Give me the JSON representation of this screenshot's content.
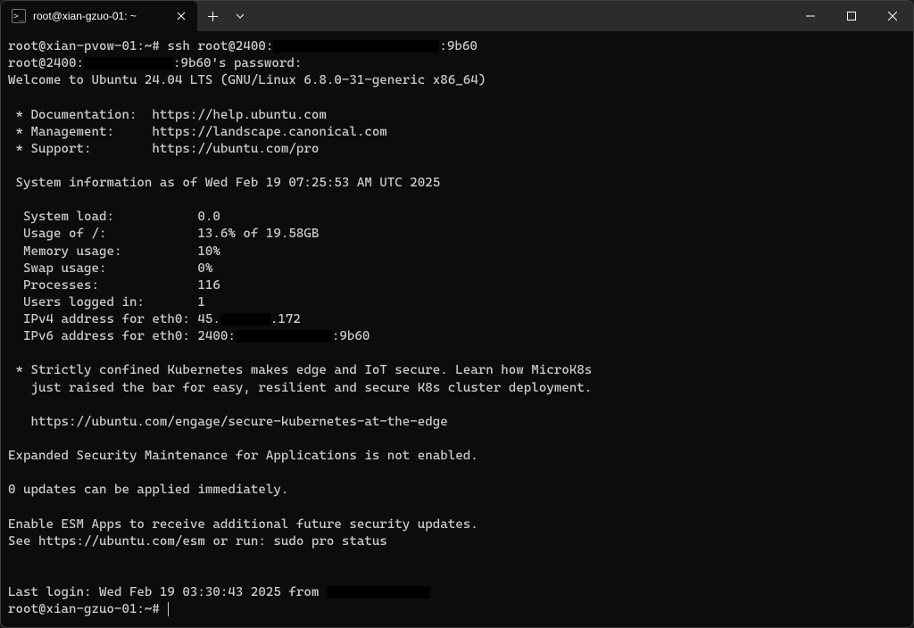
{
  "window": {
    "tab_title": "root@xian-gzuo-01: ~",
    "tab_icon_glyph": ">_"
  },
  "terminal": {
    "prompt1_user_host": "root@xian-pvow-01:~# ",
    "prompt1_cmd": "ssh root@2400:",
    "prompt1_suffix": ":9b60",
    "line2_a": "root@2400:",
    "line2_b": ":9b60's password:",
    "welcome": "Welcome to Ubuntu 24.04 LTS (GNU/Linux 6.8.0-31-generic x86_64)",
    "doc_line": " * Documentation:  https://help.ubuntu.com",
    "mgmt_line": " * Management:     https://landscape.canonical.com",
    "support_line": " * Support:        https://ubuntu.com/pro",
    "sysinfo_header": " System information as of Wed Feb 19 07:25:53 AM UTC 2025",
    "stats": {
      "load": "  System load:           0.0",
      "usage": "  Usage of /:            13.6% of 19.58GB",
      "mem": "  Memory usage:          10%",
      "swap": "  Swap usage:            0%",
      "procs": "  Processes:             116",
      "users": "  Users logged in:       1",
      "ipv4_a": "  IPv4 address for eth0: 45.",
      "ipv4_b": ".172",
      "ipv6_a": "  IPv6 address for eth0: 2400:",
      "ipv6_b": ":9b60"
    },
    "k8s_1": " * Strictly confined Kubernetes makes edge and IoT secure. Learn how MicroK8s",
    "k8s_2": "   just raised the bar for easy, resilient and secure K8s cluster deployment.",
    "k8s_link": "   https://ubuntu.com/engage/secure-kubernetes-at-the-edge",
    "esm": "Expanded Security Maintenance for Applications is not enabled.",
    "updates": "0 updates can be applied immediately.",
    "esm_enable_1": "Enable ESM Apps to receive additional future security updates.",
    "esm_enable_2": "See https://ubuntu.com/esm or run: sudo pro status",
    "last_login": "Last login: Wed Feb 19 03:30:43 2025 from ",
    "prompt2": "root@xian-gzuo-01:~# "
  }
}
